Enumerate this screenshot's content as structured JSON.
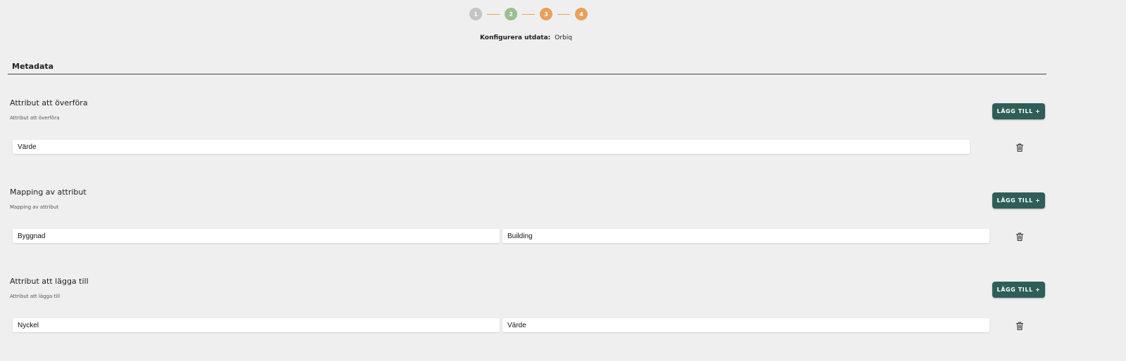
{
  "stepper": {
    "steps": [
      {
        "label": "1",
        "color": "#c4c4c4"
      },
      {
        "label": "2",
        "color": "#9cbf8d"
      },
      {
        "label": "3",
        "color": "#e8a15a"
      },
      {
        "label": "4",
        "color": "#e8a15a"
      }
    ],
    "connector_color": "#e8a15a"
  },
  "config": {
    "label": "Konfigurera utdata:",
    "value": "Orbiq"
  },
  "section": {
    "title": "Metadata"
  },
  "groups": [
    {
      "title": "Attribut att överföra",
      "subtitle": "Attribut att överföra",
      "add_label": "LÄGG TILL +",
      "fields": [
        {
          "value": "Värde"
        }
      ]
    },
    {
      "title": "Mapping av attribut",
      "subtitle": "Mapping av attribut",
      "add_label": "LÄGG TILL +",
      "fields": [
        {
          "value": "Byggnad"
        },
        {
          "value": "Building"
        }
      ]
    },
    {
      "title": "Attribut att lägga till",
      "subtitle": "Attribut att lägga till",
      "add_label": "LÄGG TILL +",
      "fields": [
        {
          "value": "Nyckel"
        },
        {
          "value": "Värde"
        }
      ]
    }
  ],
  "colors": {
    "accent": "#2e5e57",
    "background": "#efefef"
  },
  "icons": {
    "delete": "trash-icon"
  }
}
